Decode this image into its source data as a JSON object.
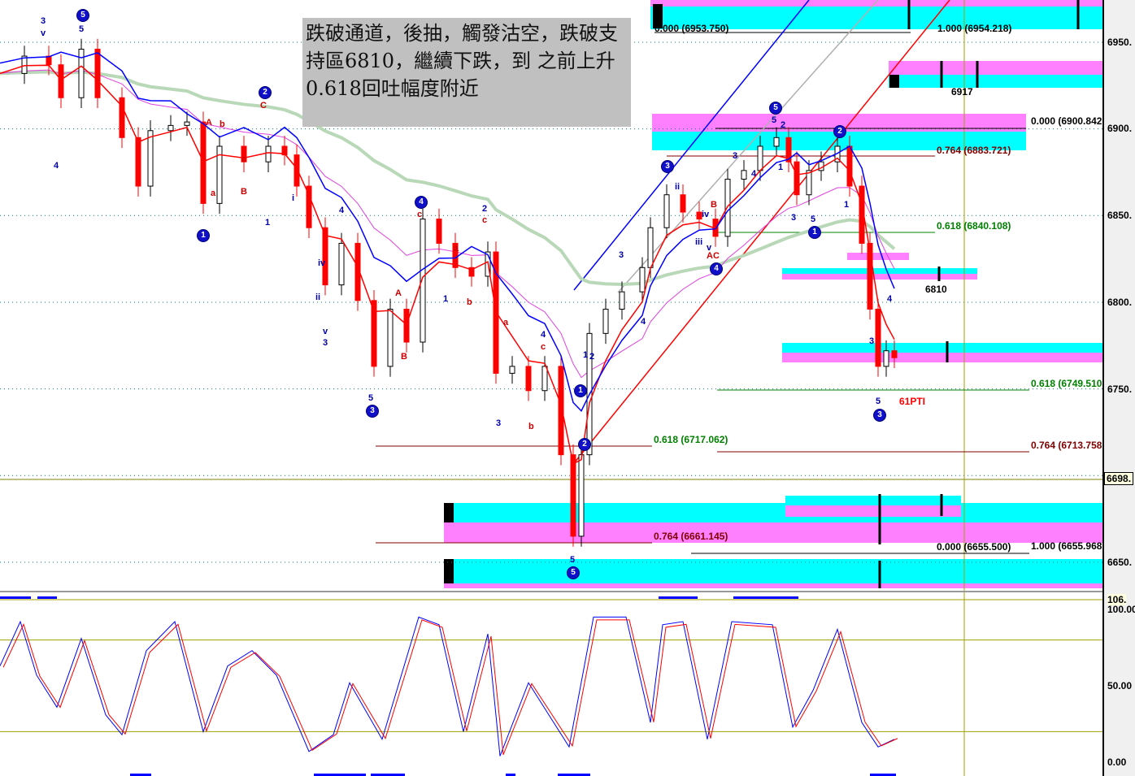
{
  "chart_data": {
    "type": "candlestick-with-indicators",
    "title": "",
    "price_axis": {
      "ticks": [
        "6950.",
        "6900.",
        "6850.",
        "6800.",
        "6750.",
        "6650."
      ],
      "current_price_label": "6698.",
      "range": [
        6640,
        6975
      ]
    },
    "oscillator_axis": {
      "ticks": [
        "100.00",
        "50.00",
        "0.00"
      ],
      "top_label": "106.",
      "range": [
        0,
        106
      ],
      "reference_levels": [
        80,
        20
      ]
    },
    "price_series": {
      "bar": [
        0,
        6,
        12,
        15,
        20,
        24,
        30,
        34,
        37,
        42,
        46,
        50,
        54,
        60,
        66,
        70,
        73,
        76,
        80,
        84,
        88,
        92,
        96,
        100,
        104,
        108,
        112,
        116,
        120,
        122,
        126,
        130,
        134,
        138,
        141,
        143,
        145,
        149,
        153,
        158,
        160,
        164,
        168,
        172,
        176,
        179,
        183,
        187,
        191,
        194,
        196,
        199,
        202,
        206,
        209,
        212,
        214,
        216,
        218,
        220
      ],
      "close": [
        6932,
        6942,
        6937,
        6918,
        6946,
        6918,
        6895,
        6867,
        6899,
        6902,
        6904,
        6857,
        6890,
        6881,
        6890,
        6885,
        6867,
        6843,
        6810,
        6834,
        6801,
        6763,
        6796,
        6777,
        6848,
        6834,
        6820,
        6815,
        6829,
        6759,
        6763,
        6749,
        6763,
        6712,
        6665,
        6712,
        6782,
        6796,
        6806,
        6820,
        6843,
        6862,
        6852,
        6848,
        6838,
        6871,
        6876,
        6890,
        6895,
        6881,
        6862,
        6876,
        6881,
        6890,
        6867,
        6834,
        6796,
        6763,
        6772,
        6768
      ]
    },
    "oscillator_series": {
      "bar": [
        0,
        5,
        9,
        14,
        20,
        26,
        30,
        36,
        43,
        50,
        56,
        62,
        68,
        76,
        82,
        86,
        94,
        103,
        108,
        114,
        120,
        123,
        130,
        140,
        146,
        154,
        160,
        163,
        168,
        174,
        180,
        190,
        195,
        200,
        206,
        212,
        216,
        220
      ],
      "value": [
        63,
        92,
        57,
        36,
        81,
        31,
        18,
        73,
        92,
        20,
        63,
        73,
        57,
        7,
        18,
        52,
        15,
        95,
        90,
        20,
        84,
        4,
        52,
        10,
        95,
        95,
        26,
        90,
        92,
        15,
        92,
        90,
        23,
        47,
        87,
        26,
        10,
        15
      ]
    },
    "fib_levels": [
      {
        "text": "0.000 (6953.750)",
        "color": "#000000"
      },
      {
        "text": "1.000 (6954.218)",
        "color": "#000000"
      },
      {
        "text": "0.000 (6900.842",
        "color": "#000000"
      },
      {
        "text": "0.764 (6883.721)",
        "color": "#800000"
      },
      {
        "text": "0.618 (6840.108)",
        "color": "#008000"
      },
      {
        "text": "0.618 (6749.510",
        "color": "#008000"
      },
      {
        "text": "0.618 (6717.062)",
        "color": "#008000"
      },
      {
        "text": "0.764 (6713.758",
        "color": "#800000"
      },
      {
        "text": "0.764 (6661.145)",
        "color": "#800000"
      },
      {
        "text": "0.000 (6655.500)",
        "color": "#000000"
      },
      {
        "text": "1.000 (6655.968",
        "color": "#000000"
      }
    ],
    "zone_labels": [
      "6917",
      "6810"
    ],
    "signal_label": "61PTI",
    "annotation": "跌破通道，後抽，觸發沽空，跌破支持區6810，繼續下跌，到 之前上升0.618回吐幅度附近",
    "wave_labels_circled": [
      "5",
      "2",
      "1",
      "4",
      "3",
      "5",
      "1",
      "2",
      "3",
      "4",
      "5",
      "1",
      "2",
      "3"
    ],
    "wave_labels": [
      "3",
      "v",
      "5",
      "4",
      "A",
      "b",
      "a",
      "C",
      "c",
      "B",
      "1",
      "i",
      "iv",
      "ii",
      "v",
      "3",
      "4",
      "A",
      "B",
      "5",
      "c",
      "a",
      "1",
      "b",
      "2",
      "c",
      "3",
      "a",
      "4",
      "c",
      "b",
      "5",
      "1",
      "2",
      "3",
      "4",
      "ii",
      "iii",
      "iv",
      "v",
      "AC",
      "B",
      "3",
      "4",
      "5",
      "2",
      "1",
      "3",
      "5",
      "1",
      "4",
      "3",
      "5"
    ],
    "colors": {
      "cyan": "#00ffff",
      "magenta": "#ff80ff",
      "blue_line": "#0000ff",
      "red_line": "#ff0000",
      "ma_green": "#b8d8b8",
      "ma_magenta": "#e040e0",
      "olive": "#a0a000"
    }
  }
}
